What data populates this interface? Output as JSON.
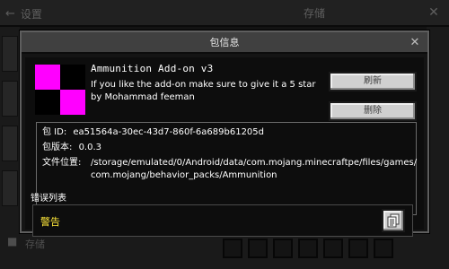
{
  "background": {
    "back_label": "设置",
    "screen_title": "存储",
    "bottom_label": "存储"
  },
  "dialog": {
    "title": "包信息",
    "pack": {
      "icon_colors": [
        "#ff00ff",
        "#000000",
        "#000000",
        "#ff00ff"
      ],
      "name": "Ammunition Add-on v3",
      "description": "If you like the add-on make sure to give it a 5 star by Mohammad feeman"
    },
    "buttons": {
      "refresh": "刷新",
      "delete": "删除"
    },
    "info": {
      "id_label": "包 ID:",
      "id_value": "ea51564a-30ec-43d7-860f-6a689b61205d",
      "version_label": "包版本:",
      "version_value": "0.0.3",
      "location_label": "文件位置:",
      "location_value": "/storage/emulated/0/Android/data/com.mojang.minecraftpe/files/games/com.mojang/behavior_packs/Ammunition"
    },
    "errors": {
      "heading": "错误列表",
      "warning_label": "警告"
    }
  }
}
